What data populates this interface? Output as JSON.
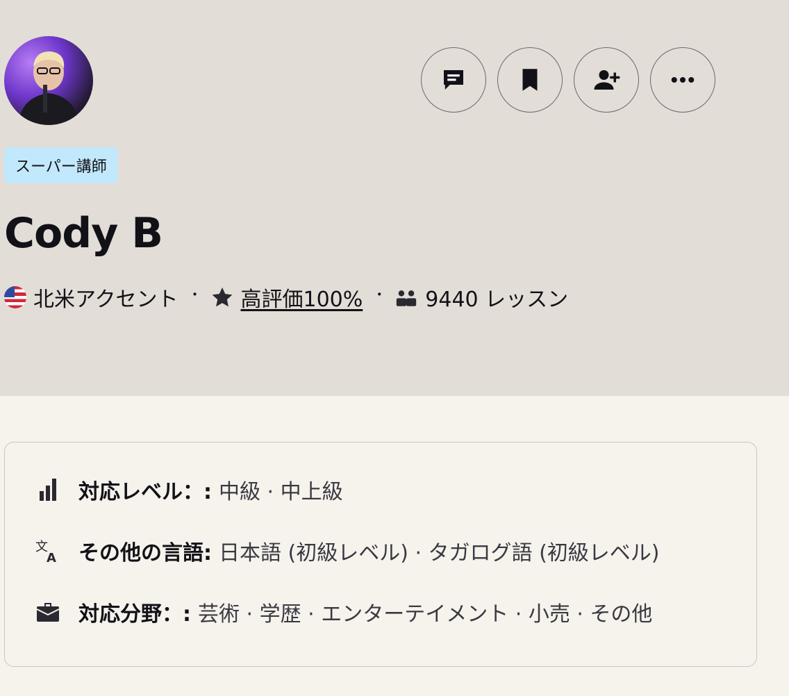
{
  "badge": "スーパー講師",
  "tutor": {
    "name": "Cody B"
  },
  "meta": {
    "accent": "北米アクセント",
    "rating": "高評価100%",
    "lessons": "9440 レッスン",
    "separator": "・"
  },
  "actions": [
    {
      "icon": "message-icon"
    },
    {
      "icon": "bookmark-icon"
    },
    {
      "icon": "add-user-icon"
    },
    {
      "icon": "more-icon"
    }
  ],
  "details": {
    "level_label": "対応レベル：:",
    "level_value": "中級 · 中上級",
    "languages_label": "その他の言語:",
    "languages_value": "日本語 (初級レベル) · タガログ語 (初級レベル)",
    "specialties_label": "対応分野：:",
    "specialties_value": "芸術 · 学歴 · エンターテイメント · 小売 · その他"
  },
  "colors": {
    "header_bg": "#e3ddd7",
    "page_bg": "#f6f2ec",
    "badge_bg": "#c1e8fb",
    "text": "#121117"
  }
}
